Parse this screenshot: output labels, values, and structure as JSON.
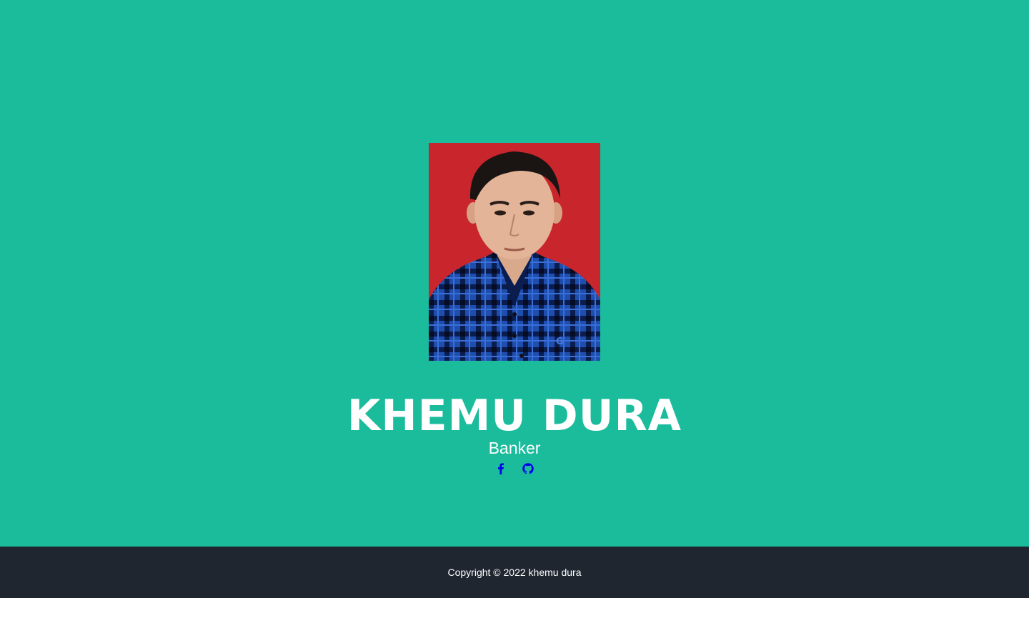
{
  "profile": {
    "name": "KHEMU DURA",
    "role": "Banker",
    "photo_alt": "profile photo"
  },
  "socials": [
    {
      "icon": "facebook-icon",
      "label": "Facebook"
    },
    {
      "icon": "github-icon",
      "label": "GitHub"
    }
  ],
  "footer": {
    "copyright": "Copyright © 2022 khemu dura"
  },
  "colors": {
    "hero_bg": "#1abc9c",
    "footer_bg": "#1f2630",
    "photo_bg": "#c8262c",
    "icon_color": "#0000ee"
  }
}
